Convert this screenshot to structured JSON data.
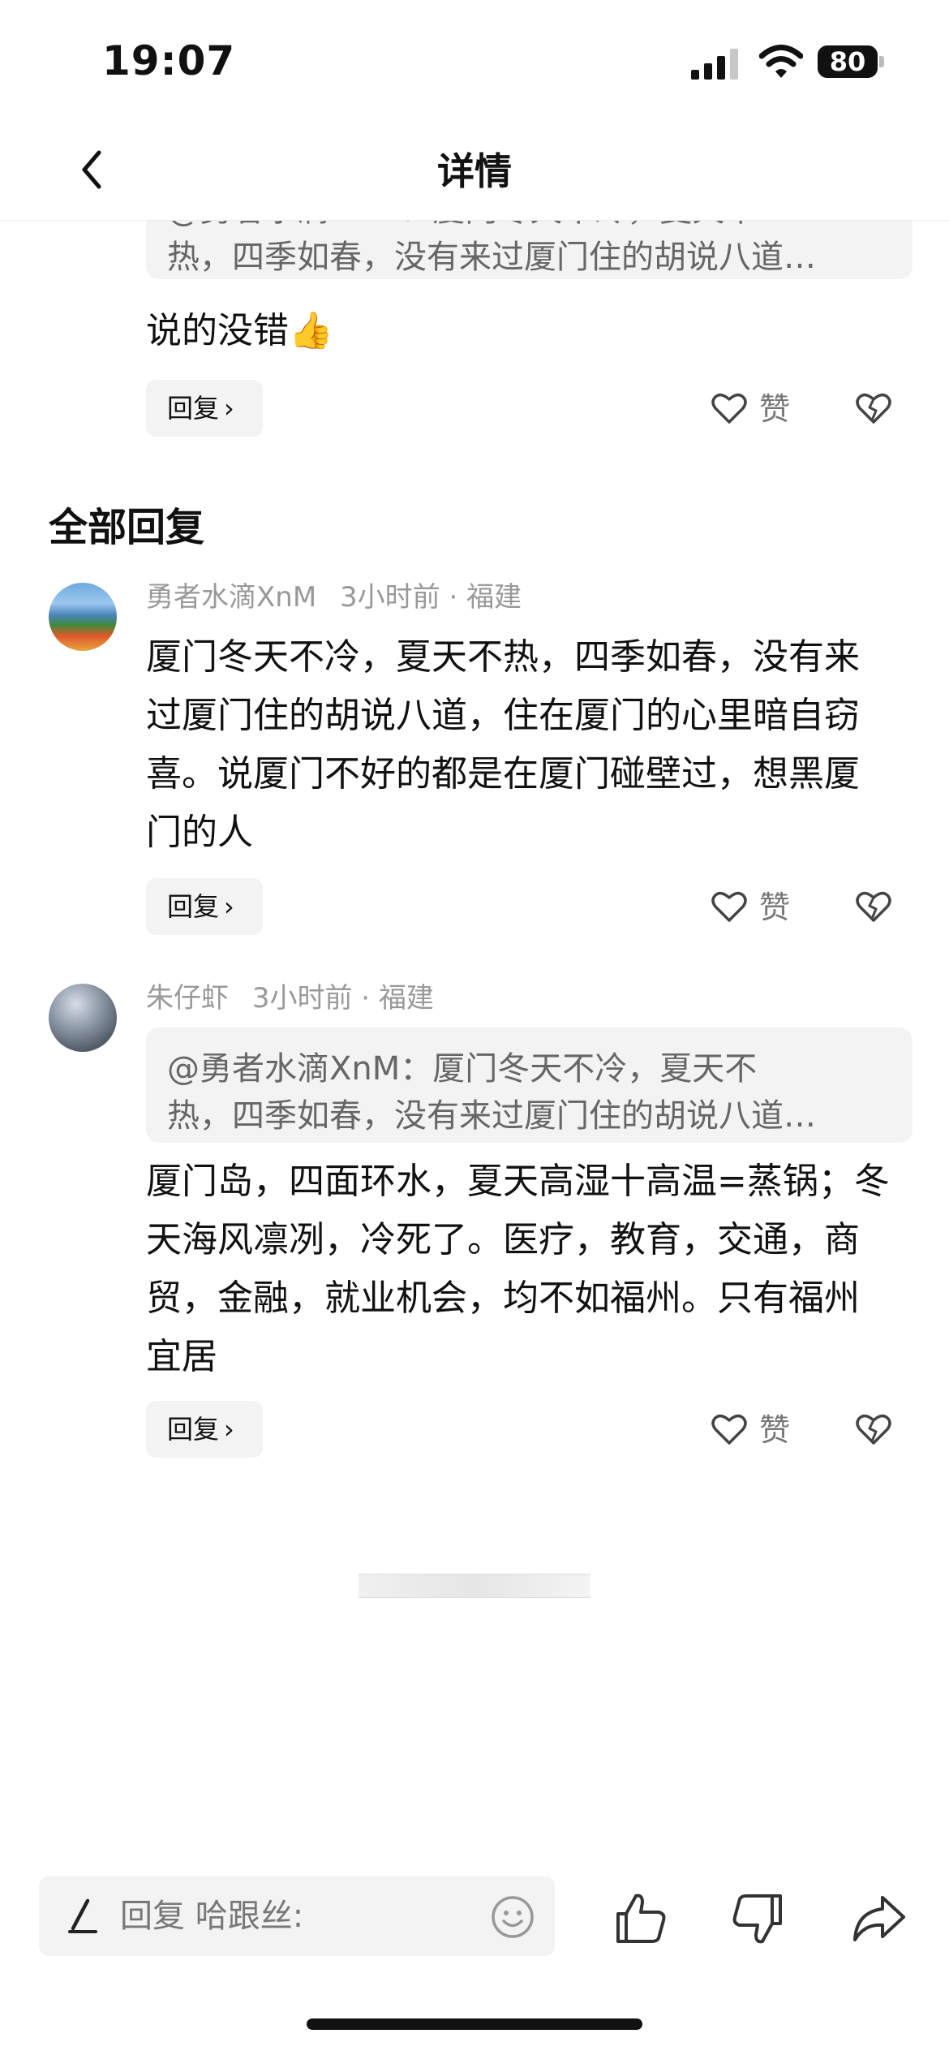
{
  "status_bar": {
    "time": "19:07",
    "battery": "80"
  },
  "nav": {
    "title": "详情",
    "back_icon": "chevron-left-icon"
  },
  "top_comment": {
    "quote_line1": "@勇者水滴XnM：厦门冬天不冷，夏天不",
    "quote_line2": "热，四季如春，没有来过厦门住的胡说八道…",
    "text": "说的没错👍",
    "reply_label": "回复",
    "like_label": "赞"
  },
  "section": {
    "title": "全部回复"
  },
  "replies": [
    {
      "author": "勇者水滴XnM",
      "time": "3小时前",
      "location": "福建",
      "text": "厦门冬天不冷，夏天不热，四季如春，没有来过厦门住的胡说八道，住在厦门的心里暗自窃喜。说厦门不好的都是在厦门碰壁过，想黑厦门的人",
      "reply_label": "回复",
      "like_label": "赞"
    },
    {
      "author": "朱仔虾",
      "time": "3小时前",
      "location": "福建",
      "quote_line1": "@勇者水滴XnM：厦门冬天不冷，夏天不",
      "quote_line2": "热，四季如春，没有来过厦门住的胡说八道…",
      "text": "厦门岛，四面环水，夏天高湿十高温=蒸锅；冬天海风凛冽，冷死了。医疗，教育，交通，商贸，金融，就业机会，均不如福州。只有福州宜居",
      "reply_label": "回复",
      "like_label": "赞"
    }
  ],
  "bottom_bar": {
    "input_placeholder": "回复 哈跟丝:",
    "icons": [
      "pen-icon",
      "emoji-icon",
      "thumbs-up-icon",
      "thumbs-down-icon",
      "share-icon"
    ]
  }
}
